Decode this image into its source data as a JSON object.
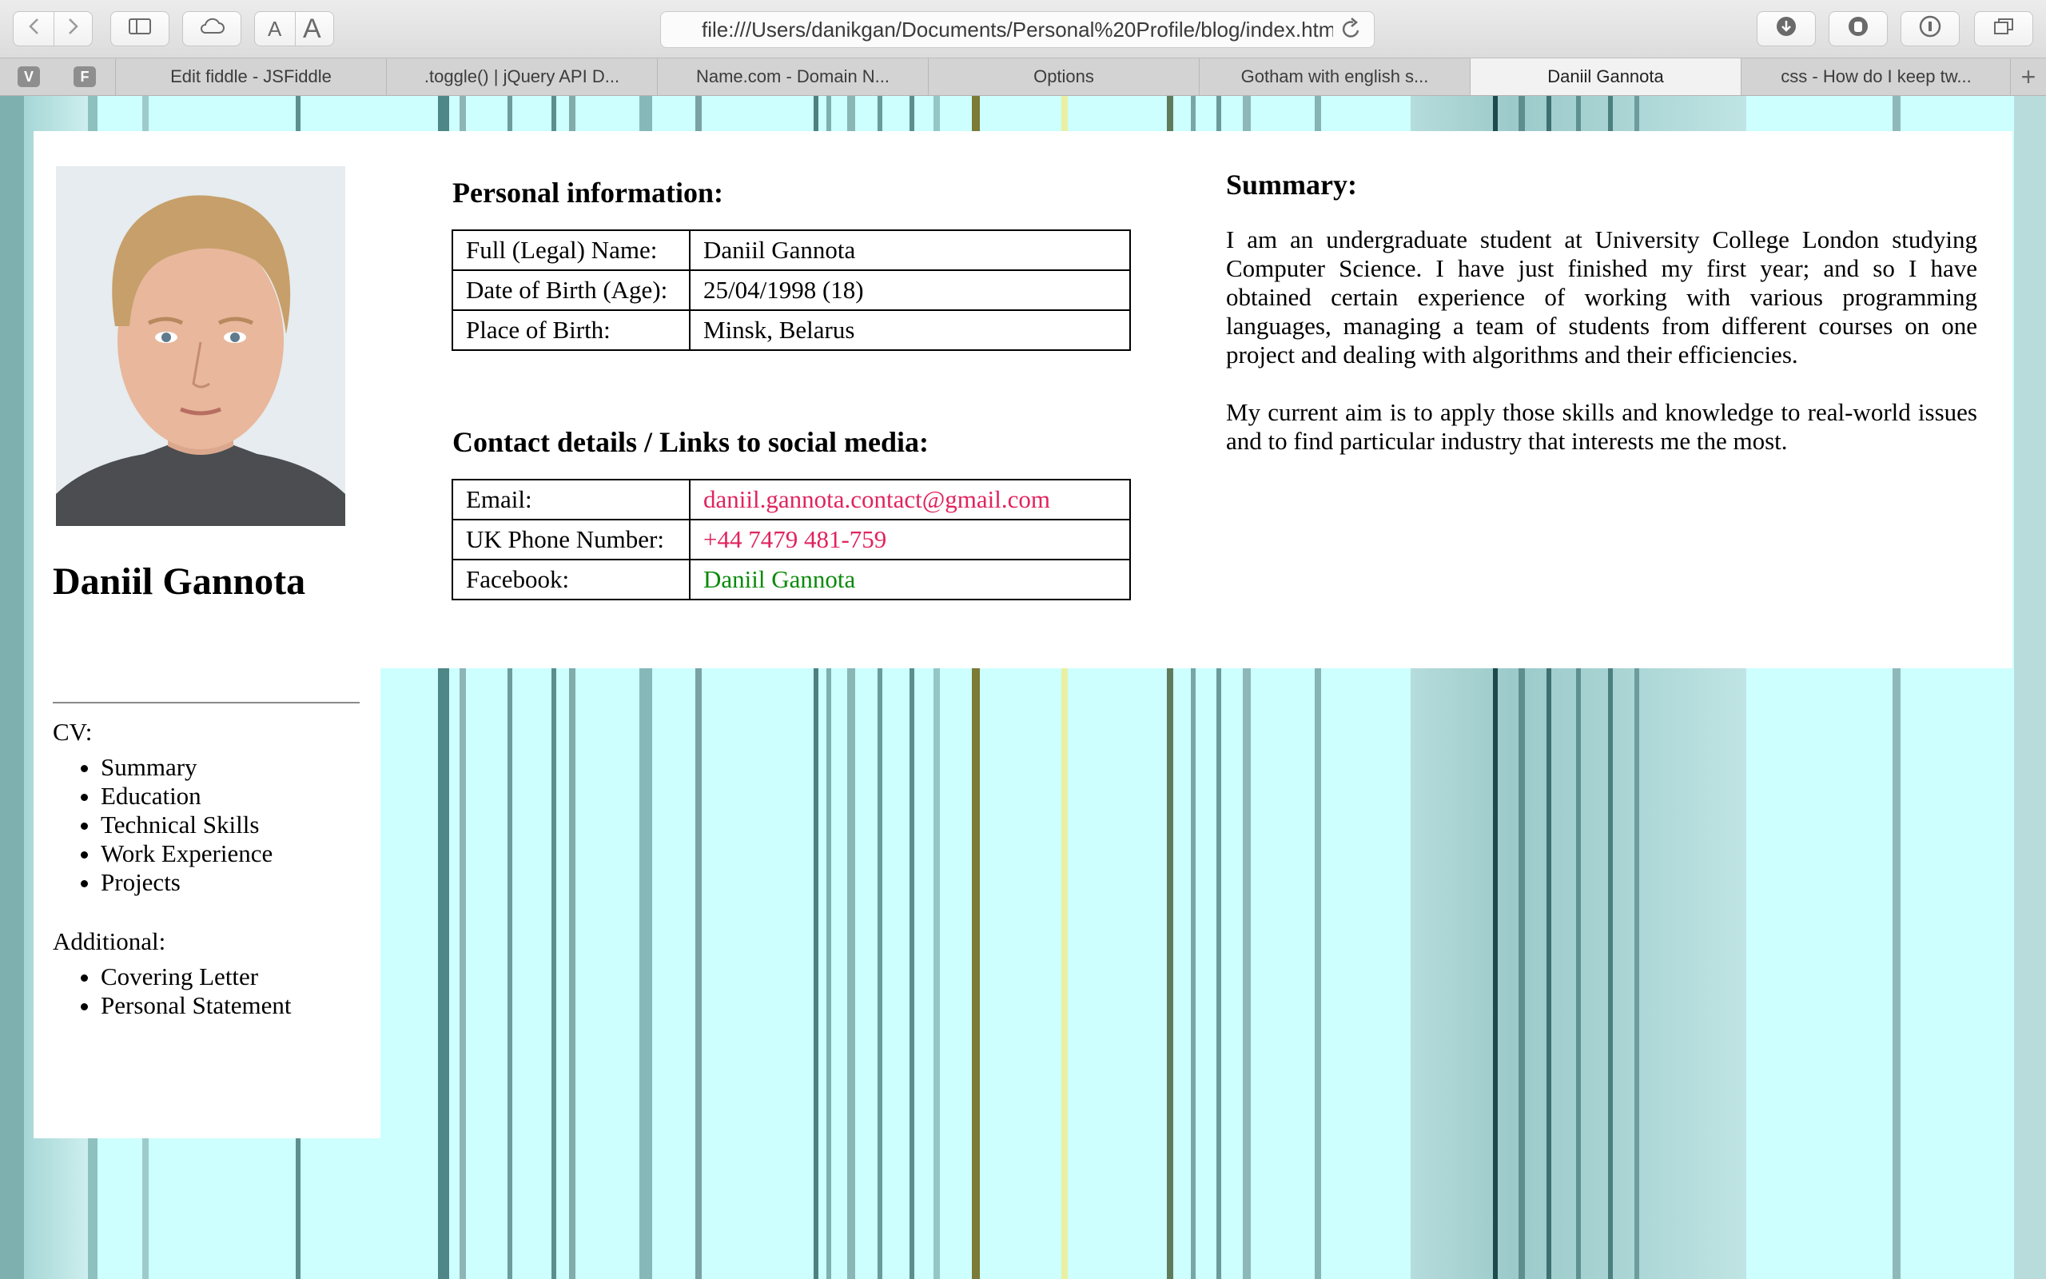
{
  "browser": {
    "url": "file:///Users/danikgan/Documents/Personal%20Profile/blog/index.html",
    "toolbar_buttons": {
      "font_small": "A",
      "font_large": "A"
    },
    "pinned_tabs": [
      "V",
      "F"
    ],
    "tabs": [
      {
        "title": "Edit fiddle - JSFiddle",
        "active": false
      },
      {
        "title": ".toggle() | jQuery API D...",
        "active": false
      },
      {
        "title": "Name.com - Domain N...",
        "active": false
      },
      {
        "title": "Options",
        "active": false
      },
      {
        "title": "Gotham with english s...",
        "active": false
      },
      {
        "title": "Daniil Gannota",
        "active": true
      },
      {
        "title": "css - How do I keep tw...",
        "active": false
      }
    ],
    "new_tab": "+"
  },
  "profile": {
    "name": "Daniil Gannota",
    "cv_label": "CV:",
    "cv_links": [
      "Summary",
      "Education",
      "Technical Skills",
      "Work Experience",
      "Projects"
    ],
    "additional_label": "Additional:",
    "additional_links": [
      "Covering Letter",
      "Personal Statement"
    ]
  },
  "personal": {
    "heading": "Personal information:",
    "rows": [
      {
        "label": "Full (Legal) Name:",
        "value": "Daniil Gannota"
      },
      {
        "label": "Date of Birth (Age):",
        "value": "25/04/1998 (18)"
      },
      {
        "label": "Place of Birth:",
        "value": "Minsk, Belarus"
      }
    ]
  },
  "contact": {
    "heading": "Contact details / Links to social media:",
    "rows": [
      {
        "label": "Email:",
        "value": "daniil.gannota.contact@gmail.com"
      },
      {
        "label": "UK Phone Number:",
        "value": "+44 7479 481-759"
      },
      {
        "label": "Facebook:",
        "value": "Daniil Gannota"
      }
    ]
  },
  "summary": {
    "heading": "Summary:",
    "paragraphs": [
      "I am an undergraduate student at University College London studying Computer Science. I have just finished my first year; and so I have obtained certain experience of working with various programming languages, managing a team of students from different courses on one project and dealing with algorithms and their efficiencies.",
      "My current aim is to apply those skills and knowledge to real-world issues and to find particular industry that interests me the most."
    ]
  },
  "colors": {
    "page_background": "#ccfffe",
    "link_pink": "#e0245e",
    "link_green": "#0a8a0a"
  }
}
